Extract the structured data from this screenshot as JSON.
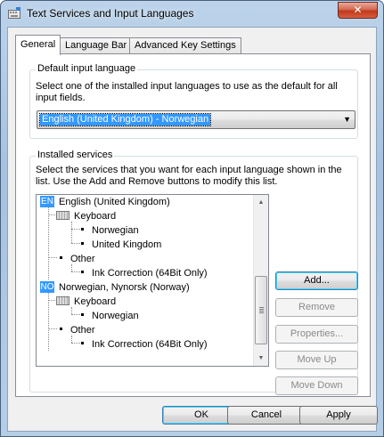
{
  "window": {
    "title": "Text Services and Input Languages",
    "close_label": "✕"
  },
  "tabs": [
    {
      "label": "General",
      "active": true
    },
    {
      "label": "Language Bar",
      "active": false
    },
    {
      "label": "Advanced Key Settings",
      "active": false
    }
  ],
  "default_language": {
    "group_label": "Default input language",
    "description": "Select one of the installed input languages to use as the default for all input fields.",
    "selected": "English (United Kingdom) - Norwegian"
  },
  "installed_services": {
    "group_label": "Installed services",
    "description": "Select the services that you want for each input language shown in the list. Use the Add and Remove buttons to modify this list.",
    "tree": {
      "lang1_code": "EN",
      "lang1_name": "English (United Kingdom)",
      "lang1_keyboard": "Keyboard",
      "lang1_kb1": "Norwegian",
      "lang1_kb2": "United Kingdom",
      "lang1_other": "Other",
      "lang1_other1": "Ink Correction (64Bit Only)",
      "lang2_code": "NO",
      "lang2_name": "Norwegian, Nynorsk (Norway)",
      "lang2_keyboard": "Keyboard",
      "lang2_kb1": "Norwegian",
      "lang2_other": "Other",
      "lang2_other1": "Ink Correction (64Bit Only)"
    },
    "buttons": {
      "add": "Add...",
      "remove": "Remove",
      "properties": "Properties...",
      "move_up": "Move Up",
      "move_down": "Move Down"
    }
  },
  "dialog_buttons": {
    "ok": "OK",
    "cancel": "Cancel",
    "apply": "Apply"
  },
  "colors": {
    "selection": "#3399ff",
    "title_bar": "#bcd3ea",
    "close_button": "#c2391c"
  }
}
